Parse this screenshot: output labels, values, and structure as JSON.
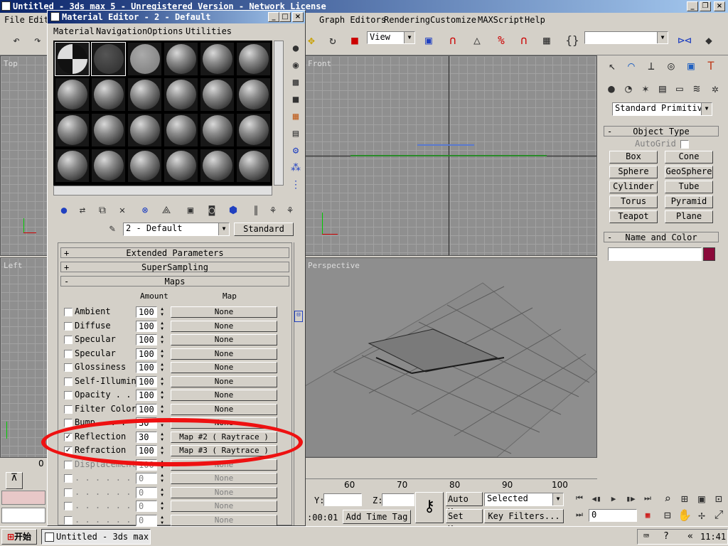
{
  "main_window": {
    "title": "Untitled - 3ds max 5 - Unregistered Version - Network License"
  },
  "menu": {
    "file": "File",
    "edit": "Edit",
    "graph_editors": "Graph Editors",
    "rendering": "Rendering",
    "customize": "Customize",
    "maxscript": "MAXScript",
    "help": "Help"
  },
  "toolbar": {
    "view_select": "View"
  },
  "viewports": {
    "top": "Top",
    "front": "Front",
    "left": "Left",
    "perspective": "Perspective"
  },
  "command_panel": {
    "category": "Standard Primitiv",
    "object_type_title": "Object Type",
    "autogrid": "AutoGrid",
    "buttons": [
      "Box",
      "Cone",
      "Sphere",
      "GeoSphere",
      "Cylinder",
      "Tube",
      "Torus",
      "Pyramid",
      "Teapot",
      "Plane"
    ],
    "name_color_title": "Name and Color",
    "object_color": "#8b0a3a"
  },
  "material_editor": {
    "title": "Material Editor - 2 - Default",
    "menu": [
      "Material",
      "Navigation",
      "Options",
      "Utilities"
    ],
    "material_name": "2 - Default",
    "material_type": "Standard",
    "rollouts": {
      "extended": "Extended Parameters",
      "supersampling": "SuperSampling",
      "maps": "Maps"
    },
    "headers": {
      "amount": "Amount",
      "map": "Map"
    },
    "rows": [
      {
        "label": "Ambient",
        "amount": "100",
        "map": "None",
        "checked": false
      },
      {
        "label": "Diffuse",
        "amount": "100",
        "map": "None",
        "checked": false
      },
      {
        "label": "Specular",
        "amount": "100",
        "map": "None",
        "checked": false
      },
      {
        "label": "Specular",
        "amount": "100",
        "map": "None",
        "checked": false
      },
      {
        "label": "Glossiness",
        "amount": "100",
        "map": "None",
        "checked": false
      },
      {
        "label": "Self-Illumin",
        "amount": "100",
        "map": "None",
        "checked": false
      },
      {
        "label": "Opacity . .",
        "amount": "100",
        "map": "None",
        "checked": false
      },
      {
        "label": "Filter Color",
        "amount": "100",
        "map": "None",
        "checked": false
      },
      {
        "label": "Bump . . .",
        "amount": "30",
        "map": "None",
        "checked": false
      },
      {
        "label": "Reflection",
        "amount": "30",
        "map": "Map #2  ( Raytrace )",
        "checked": true
      },
      {
        "label": "Refraction",
        "amount": "100",
        "map": "Map #3  ( Raytrace )",
        "checked": true
      },
      {
        "label": "Displacement",
        "amount": "100",
        "map": "None",
        "checked": false
      },
      {
        "label": ". . . . . .",
        "amount": "0",
        "map": "None",
        "checked": false
      },
      {
        "label": ". . . . . .",
        "amount": "0",
        "map": "None",
        "checked": false
      },
      {
        "label": ". . . . . .",
        "amount": "0",
        "map": "None",
        "checked": false
      },
      {
        "label": ". . . . . .",
        "amount": "0",
        "map": "None",
        "checked": false
      }
    ]
  },
  "timeline": {
    "ticks": [
      "60",
      "70",
      "80",
      "90",
      "100"
    ],
    "left_tick": "0"
  },
  "status": {
    "y_label": "Y:",
    "z_label": "Z:",
    "time": ":00:01",
    "add_time_tag": "Add Time Tag",
    "auto_key": "Auto Key",
    "set_key": "Set Key",
    "selected": "Selected",
    "key_filters": "Key Filters...",
    "frame": "0"
  },
  "taskbar": {
    "start": "开始",
    "task": "Untitled - 3ds max ...",
    "clock": "11:41"
  }
}
